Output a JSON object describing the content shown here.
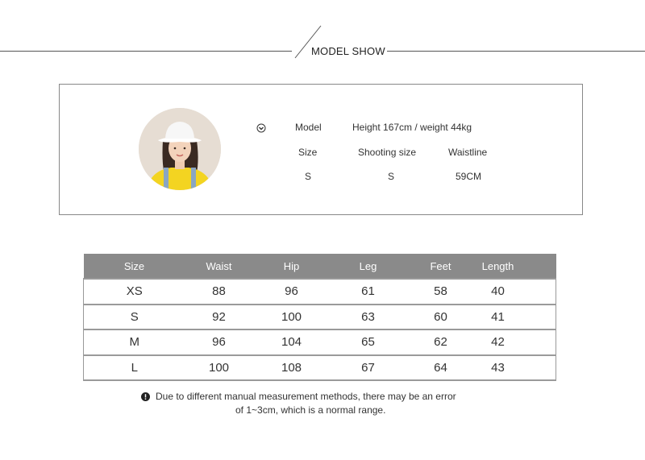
{
  "header": {
    "title": "MODEL SHOW"
  },
  "model": {
    "row1": {
      "label": "Model",
      "value": "Height 167cm / weight 44kg"
    },
    "headers": [
      "Size",
      "Shooting size",
      "Waistline"
    ],
    "values": [
      "S",
      "S",
      "59CM"
    ]
  },
  "size_table": {
    "columns": [
      "Size",
      "Waist",
      "Hip",
      "Leg",
      "Feet",
      "Length"
    ],
    "rows": [
      [
        "XS",
        "88",
        "96",
        "61",
        "58",
        "40"
      ],
      [
        "S",
        "92",
        "100",
        "63",
        "60",
        "41"
      ],
      [
        "M",
        "96",
        "104",
        "65",
        "62",
        "42"
      ],
      [
        "L",
        "100",
        "108",
        "67",
        "64",
        "43"
      ]
    ]
  },
  "note": {
    "line1": "Due to different manual measurement methods, there may be an error",
    "line2": "of 1~3cm, which is a normal range."
  },
  "icons": {
    "chevron": "chevron-down-circle-icon",
    "warning": "exclamation-circle-icon"
  },
  "colors": {
    "table_header": "#8a8a8a",
    "border": "#9a9a9a"
  }
}
